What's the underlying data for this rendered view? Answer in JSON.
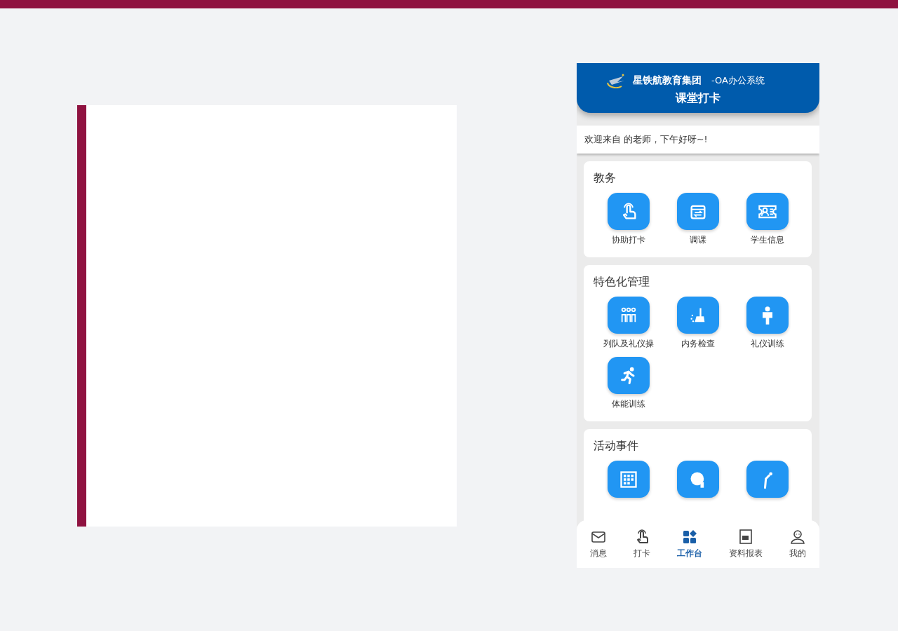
{
  "header": {
    "org": "星铁航教育集团",
    "system": "-OA办公系统",
    "title": "课堂打卡"
  },
  "welcome": "欢迎来自 的老师，下午好呀~!",
  "sections": [
    {
      "title": "教务",
      "items": [
        {
          "kind": "tap",
          "label": "协助打卡"
        },
        {
          "kind": "calendar",
          "label": "调课"
        },
        {
          "kind": "idcard",
          "label": "学生信息"
        }
      ]
    },
    {
      "title": "特色化管理",
      "items": [
        {
          "kind": "people",
          "label": "列队及礼仪操"
        },
        {
          "kind": "broom",
          "label": "内务检查"
        },
        {
          "kind": "person",
          "label": "礼仪训练"
        },
        {
          "kind": "runner",
          "label": "体能训练"
        }
      ]
    },
    {
      "title": "活动事件",
      "items": [
        {
          "kind": "grid"
        },
        {
          "kind": "globe"
        },
        {
          "kind": "bow"
        }
      ]
    }
  ],
  "tabs": [
    {
      "kind": "mail",
      "label": "消息",
      "selected": false
    },
    {
      "kind": "tap",
      "label": "打卡",
      "selected": false
    },
    {
      "kind": "apps",
      "label": "工作台",
      "selected": true
    },
    {
      "kind": "report",
      "label": "资料报表",
      "selected": false
    },
    {
      "kind": "user",
      "label": "我的",
      "selected": false
    }
  ]
}
